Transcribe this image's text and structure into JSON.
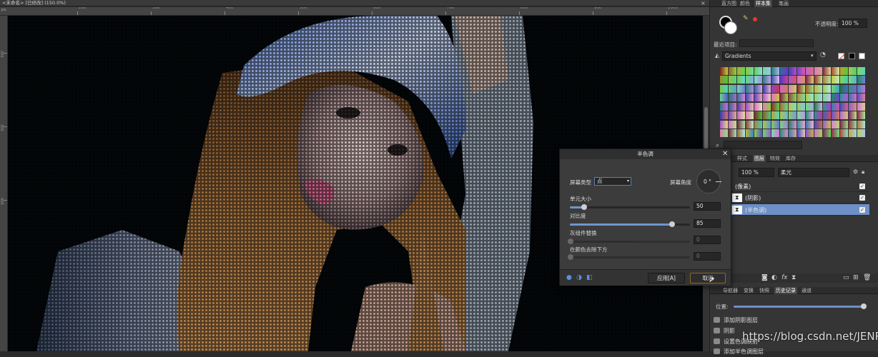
{
  "document": {
    "tab_title": "<未命名> [已修改] (150.0%)",
    "close_glyph": "×"
  },
  "ruler": {
    "unit": "px",
    "x_labels": [
      "200",
      "300",
      "400",
      "500",
      "600",
      "700",
      "800",
      "900",
      "1000"
    ],
    "y_labels": [
      "200",
      "300",
      "400"
    ]
  },
  "right_panel": {
    "top_tabs": [
      "直方图",
      "颜色",
      "样本集",
      "笔画"
    ],
    "opacity_label": "不透明度:",
    "opacity_value": "100 %",
    "recent_label": "最近项目:",
    "gradient_category": "Gradients",
    "search_placeholder": "",
    "layer_tabs": [
      "样式",
      "图层",
      "特效",
      "库存"
    ],
    "layer_opacity_value": "100 %",
    "layer_blend_mode": "柔光",
    "layers": [
      {
        "name": "(像素)",
        "selected": false
      },
      {
        "name": "(阴影)",
        "selected": false
      },
      {
        "name": "(半色调)",
        "selected": true
      }
    ],
    "history_tabs": [
      "导航器",
      "变换",
      "快照",
      "历史记录",
      "通道"
    ],
    "history_position_label": "位置:",
    "history_items": [
      "添加阴影图层",
      "阴影",
      "设置色调映射",
      "添加半色调图层"
    ]
  },
  "halftone_dialog": {
    "title": "半色调",
    "screen_type_label": "屏幕类型",
    "screen_type_value": "点",
    "screen_angle_label": "屏幕角度",
    "screen_angle_value": "0 °",
    "cell_size_label": "单元大小",
    "cell_size_value": "50",
    "cell_size_fraction": 0.12,
    "contrast_label": "对比度",
    "contrast_value": "85",
    "contrast_fraction": 0.85,
    "gray_label": "灰组件替换",
    "gray_value": "0",
    "remove_label": "在颜色去除下方",
    "remove_value": "0",
    "apply_button": "应用[A]",
    "cancel_button": "取消"
  },
  "colors": {
    "accent": "#6c90c7",
    "panel_bg": "#353535"
  },
  "watermark": "https://blog.csdn.net/JENREY"
}
